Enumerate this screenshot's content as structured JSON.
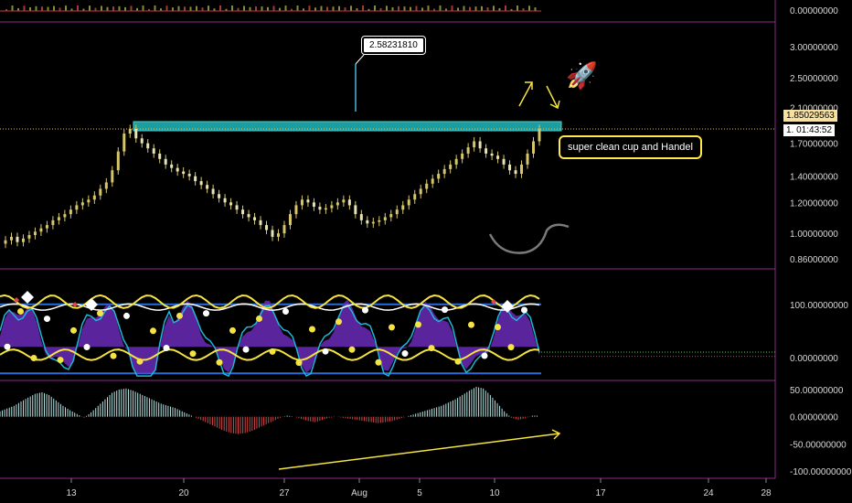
{
  "chart_data": [
    {
      "type": "line",
      "name": "volume",
      "yticks": [
        "0.00000000"
      ]
    },
    {
      "type": "candlestick",
      "yticks": [
        "3.00000000",
        "2.50000000",
        "2.10000000",
        "1.70000000",
        "1.40000000",
        "1.20000000",
        "1.00000000",
        "0.86000000"
      ],
      "ylim": [
        0.82,
        3.4
      ],
      "scale": "log",
      "close": [
        0.96,
        0.98,
        0.95,
        0.97,
        0.99,
        1.01,
        1.03,
        1.05,
        1.08,
        1.1,
        1.12,
        1.15,
        1.18,
        1.2,
        1.22,
        1.25,
        1.3,
        1.35,
        1.45,
        1.62,
        1.8,
        1.85,
        1.75,
        1.7,
        1.65,
        1.6,
        1.55,
        1.5,
        1.47,
        1.44,
        1.42,
        1.4,
        1.36,
        1.33,
        1.3,
        1.26,
        1.23,
        1.2,
        1.18,
        1.15,
        1.12,
        1.1,
        1.08,
        1.05,
        1.02,
        0.98,
        1.0,
        1.05,
        1.12,
        1.18,
        1.22,
        1.2,
        1.17,
        1.15,
        1.16,
        1.18,
        1.2,
        1.22,
        1.18,
        1.12,
        1.08,
        1.06,
        1.07,
        1.08,
        1.1,
        1.12,
        1.15,
        1.18,
        1.22,
        1.26,
        1.3,
        1.34,
        1.38,
        1.42,
        1.46,
        1.5,
        1.55,
        1.6,
        1.66,
        1.72,
        1.65,
        1.6,
        1.58,
        1.55,
        1.5,
        1.45,
        1.42,
        1.5,
        1.6,
        1.72,
        1.85
      ],
      "current_price": "1.85029563",
      "countdown": "01:43:52",
      "countdown_prefix": "1.",
      "callout": "2.58231810",
      "annotation": "super clean cup and Handel",
      "rocket_emoji": "🚀"
    },
    {
      "type": "line",
      "name": "oscillator",
      "yticks": [
        "100.00000000",
        "0.00000000"
      ],
      "ylim": [
        -40,
        160
      ]
    },
    {
      "type": "bar",
      "name": "histogram",
      "yticks": [
        "50.00000000",
        "0.00000000",
        "-50.00000000",
        "-100.00000000"
      ],
      "ylim": [
        -110,
        60
      ],
      "values": [
        10,
        15,
        20,
        28,
        35,
        42,
        45,
        40,
        30,
        20,
        12,
        5,
        -2,
        8,
        20,
        32,
        44,
        50,
        52,
        48,
        42,
        36,
        30,
        24,
        20,
        16,
        10,
        4,
        -2,
        -8,
        -14,
        -20,
        -26,
        -30,
        -32,
        -30,
        -26,
        -20,
        -14,
        -8,
        -2,
        2,
        0,
        -4,
        -8,
        -10,
        -6,
        -2,
        0,
        -2,
        -4,
        -6,
        -8,
        -10,
        -12,
        -10,
        -8,
        -4,
        0,
        4,
        8,
        12,
        16,
        20,
        26,
        32,
        40,
        48,
        55,
        52,
        40,
        25,
        10,
        -2,
        -6,
        -3,
        2
      ],
      "trendline_desc": "rising"
    }
  ],
  "xaxis": {
    "labels": [
      "13",
      "20",
      "27",
      "Aug",
      "5",
      "10",
      "17",
      "24",
      "28"
    ]
  },
  "colors": {
    "background": "#000000",
    "panel_border": "#8a2c8a",
    "candle": "#d6c66a",
    "resistance": "#1c9ea0",
    "price_line": "#f0c040",
    "yellow": "#f5e342",
    "purple": "#6a2ab8",
    "cyan": "#1fb6d8",
    "hist_pos": "#b8e6e6",
    "hist_neg": "#d44848",
    "rocket": "#3be03b"
  }
}
